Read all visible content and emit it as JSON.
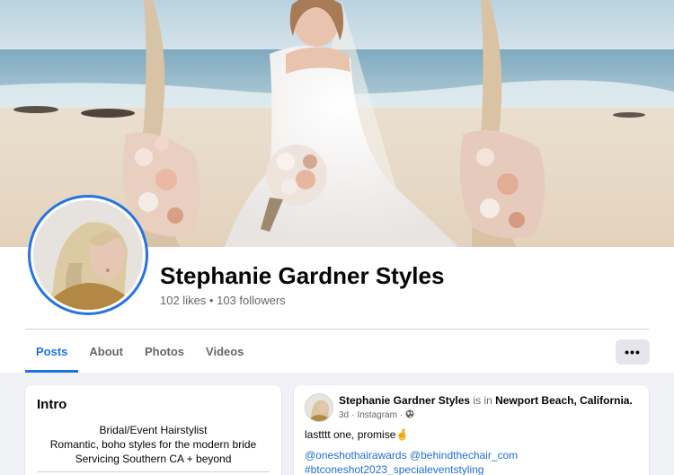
{
  "page": {
    "name": "Stephanie Gardner Styles",
    "stats": "102 likes • 103 followers"
  },
  "tabs": [
    {
      "label": "Posts",
      "active": true
    },
    {
      "label": "About",
      "active": false
    },
    {
      "label": "Photos",
      "active": false
    },
    {
      "label": "Videos",
      "active": false
    }
  ],
  "more_button": "•••",
  "intro": {
    "title": "Intro",
    "lines": [
      "Bridal/Event Hairstylist",
      "Romantic, boho styles for the modern bride",
      "Servicing Southern CA + beyond"
    ]
  },
  "post": {
    "author": "Stephanie Gardner Styles",
    "is_in": "is in",
    "location": "Newport Beach, California.",
    "time": "3d",
    "separator": "·",
    "source": "Instagram",
    "dot": "·",
    "text": "lastttt one, promise",
    "emoji": "🤞",
    "tag1": "@oneshothairawards",
    "tag2": "@behindthechair_com",
    "tag3": "#btconeshot2023_specialeventstyling"
  },
  "colors": {
    "accent": "#1b74e4",
    "link": "#216fdb",
    "muted": "#65676b"
  },
  "icons": {
    "globe": "globe-icon",
    "more": "more-icon"
  }
}
